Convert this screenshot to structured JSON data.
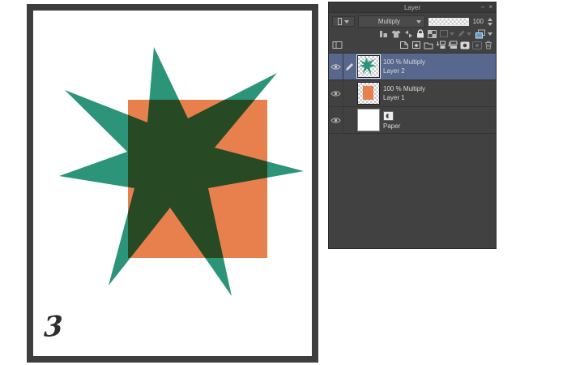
{
  "canvas": {
    "page_number": "3"
  },
  "colors": {
    "square": "#E8804E",
    "star": "#2B9479",
    "selected_row": "#57678D",
    "panel_bg": "#414141",
    "layers_icon_blue": "#5B9BD5"
  },
  "panel": {
    "title": "Layer",
    "minimize_label": "–",
    "close_label": "×",
    "blend_mode_value": "Multiply",
    "opacity_value": "100",
    "layers": [
      {
        "meta": "100 % Multiply",
        "name": "Layer 2"
      },
      {
        "meta": "100 % Multiply",
        "name": "Layer 1"
      },
      {
        "name": "Paper"
      }
    ]
  }
}
